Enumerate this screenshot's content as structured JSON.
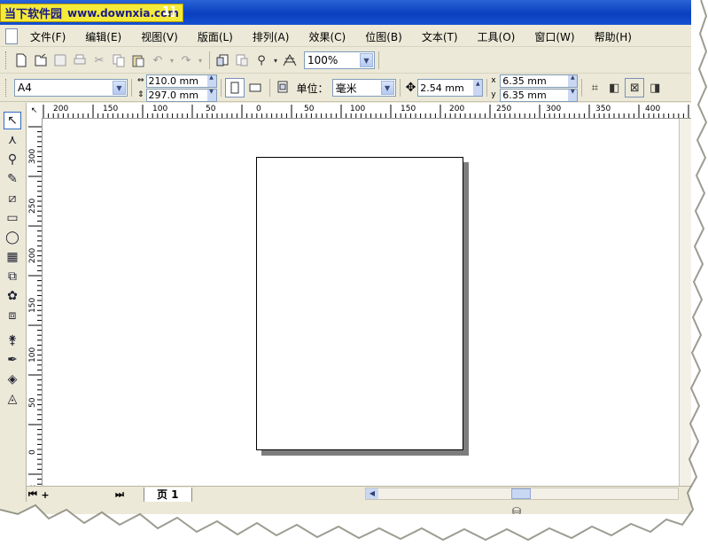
{
  "title_bar": {
    "watermark_cn": "当下软件园",
    "watermark_url": "www.downxia.com",
    "title_suffix": "1]"
  },
  "menu": [
    {
      "label": "文件(F)",
      "name": "menu-file"
    },
    {
      "label": "编辑(E)",
      "name": "menu-edit"
    },
    {
      "label": "视图(V)",
      "name": "menu-view"
    },
    {
      "label": "版面(L)",
      "name": "menu-layout"
    },
    {
      "label": "排列(A)",
      "name": "menu-arrange"
    },
    {
      "label": "效果(C)",
      "name": "menu-effects"
    },
    {
      "label": "位图(B)",
      "name": "menu-bitmaps"
    },
    {
      "label": "文本(T)",
      "name": "menu-text"
    },
    {
      "label": "工具(O)",
      "name": "menu-tools"
    },
    {
      "label": "窗口(W)",
      "name": "menu-window"
    },
    {
      "label": "帮助(H)",
      "name": "menu-help"
    }
  ],
  "toolbar": {
    "zoom": "100%"
  },
  "property_bar": {
    "paper_size": "A4",
    "width": "210.0 mm",
    "height": "297.0 mm",
    "units_label": "单位：",
    "units_value": "毫米",
    "nudge": "2.54 mm",
    "dup_x": "6.35 mm",
    "dup_y": "6.35 mm",
    "x_label": "x",
    "y_label": "y"
  },
  "rulers": {
    "unit": "毫米",
    "h_ticks": [
      "200",
      "150",
      "100",
      "50",
      "0",
      "50",
      "100",
      "150",
      "200",
      "250",
      "300",
      "350",
      "400"
    ],
    "v_ticks": [
      "300",
      "250",
      "200",
      "150",
      "100",
      "50",
      "0"
    ]
  },
  "bottom": {
    "page_tab": "页 1",
    "add_page": "+"
  },
  "colors": {
    "title_blue": "#0a3fbf",
    "chrome": "#ece9d8",
    "watermark_yellow": "#f4ea3a"
  }
}
